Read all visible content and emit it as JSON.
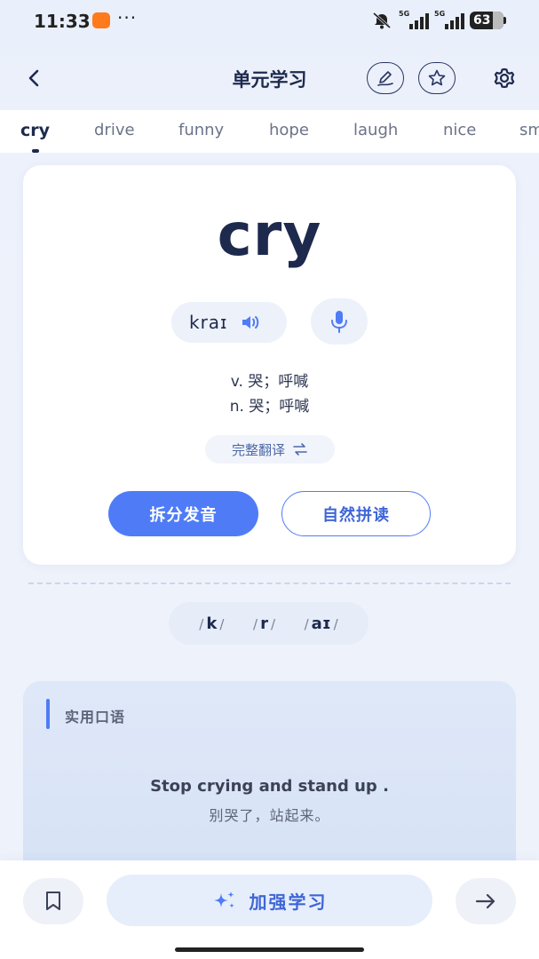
{
  "status_bar": {
    "time": "11:33",
    "dots": "···",
    "net1": "5G",
    "net2": "5G",
    "battery": "63"
  },
  "header": {
    "title": "单元学习"
  },
  "tabs": [
    {
      "label": "cry",
      "active": true
    },
    {
      "label": "drive",
      "active": false
    },
    {
      "label": "funny",
      "active": false
    },
    {
      "label": "hope",
      "active": false
    },
    {
      "label": "laugh",
      "active": false
    },
    {
      "label": "nice",
      "active": false
    },
    {
      "label": "sm",
      "active": false
    }
  ],
  "card": {
    "word": "cry",
    "phonetic": "kraɪ",
    "definitions": [
      "v. 哭；呼喊",
      "n. 哭；呼喊"
    ],
    "full_translation": "完整翻译",
    "split_button": "拆分发音",
    "phonics_button": "自然拼读"
  },
  "phonemes": [
    "k",
    "r",
    "aɪ"
  ],
  "spoken": {
    "label": "实用口语",
    "en": "Stop crying and stand up .",
    "zh": "别哭了，站起来。"
  },
  "bottom": {
    "study_label": "加强学习"
  },
  "colors": {
    "accent": "#4f7cf6",
    "title": "#1d2a4d",
    "background": "#eef2fb"
  }
}
